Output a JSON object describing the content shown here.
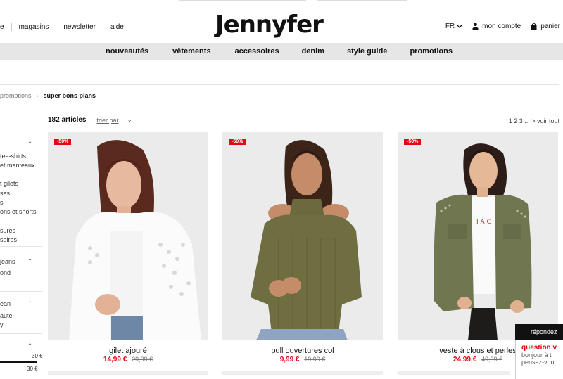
{
  "utility_links": [
    "e",
    "magasins",
    "newsletter",
    "aide"
  ],
  "logo": "Jennyfer",
  "right_utils": {
    "language": "FR",
    "account": "mon compte",
    "cart": "panier"
  },
  "nav": [
    "nouveautés",
    "vêtements",
    "accessoires",
    "denim",
    "style guide",
    "promotions"
  ],
  "breadcrumb": {
    "parent": "promotions",
    "current": "super bons plans"
  },
  "toolbar": {
    "count": "182 articles",
    "sort_label": "trier par"
  },
  "pagination": "1 2 3 ... > voir tout",
  "sidebar": {
    "items": [
      "tee-shirts",
      "et manteaux",
      "t gilets",
      "ses",
      "s",
      "ons et shorts",
      "sures",
      "soires",
      "jeans",
      "ond",
      "ean",
      "aute",
      "y"
    ],
    "price_max": "30 €",
    "price_min": "30 €"
  },
  "products": [
    {
      "badge": "-50%",
      "name": "gilet ajouré",
      "price": "14,99 €",
      "old_price": "29,99 €"
    },
    {
      "badge": "-50%",
      "name": "pull ouvertures col",
      "price": "9,99 €",
      "old_price": "19,99 €"
    },
    {
      "badge": "-50%",
      "name": "veste à clous et perles",
      "price": "24,99 €",
      "old_price": "49,99 €"
    }
  ],
  "chat": {
    "header": "répondez",
    "question": "question v",
    "message_1": "bonjour à t",
    "message_2": "pensez-vou"
  },
  "colors": {
    "accent": "#e30613",
    "nav_bg": "#e6e6e6",
    "chat_header": "#111111"
  }
}
